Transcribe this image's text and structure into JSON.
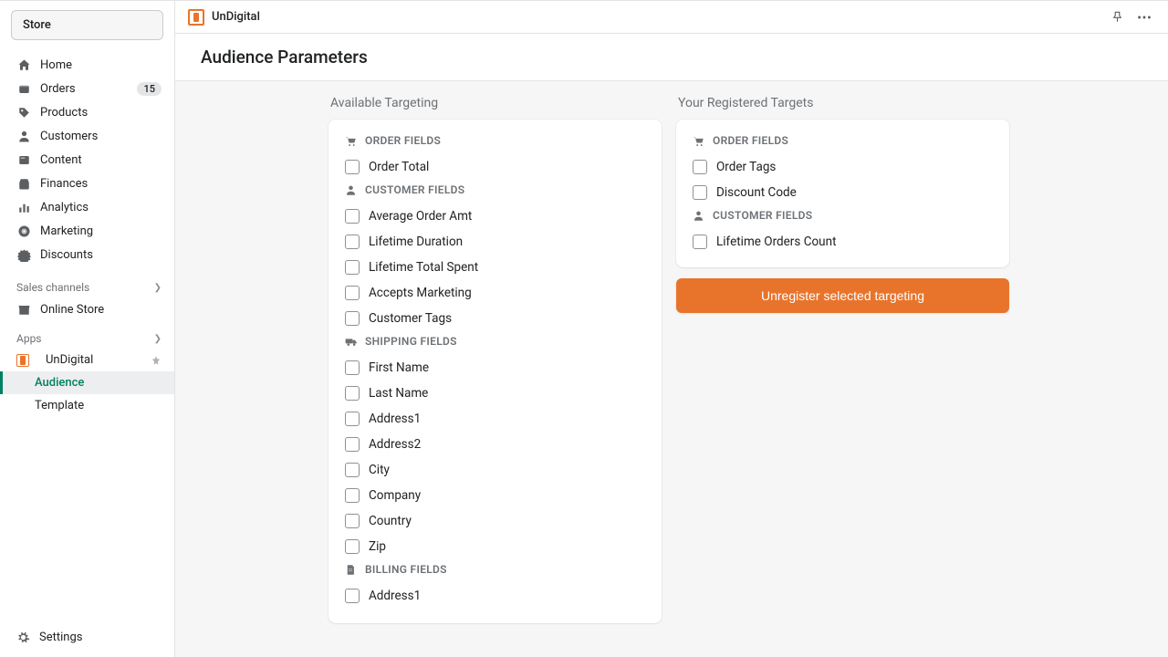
{
  "store_label": "Store",
  "nav": {
    "home": "Home",
    "orders": "Orders",
    "orders_badge": "15",
    "products": "Products",
    "customers": "Customers",
    "content": "Content",
    "finances": "Finances",
    "analytics": "Analytics",
    "marketing": "Marketing",
    "discounts": "Discounts"
  },
  "sales_channels_label": "Sales channels",
  "online_store": "Online Store",
  "apps_label": "Apps",
  "app_name": "UnDigital",
  "app_sub": {
    "audience": "Audience",
    "template": "Template"
  },
  "settings_label": "Settings",
  "topbar_title": "UnDigital",
  "page_title": "Audience Parameters",
  "columns": {
    "available_header": "Available Targeting",
    "registered_header": "Your Registered Targets"
  },
  "groups": {
    "order": "ORDER FIELDS",
    "customer": "CUSTOMER FIELDS",
    "shipping": "SHIPPING FIELDS",
    "billing": "BILLING FIELDS"
  },
  "available": {
    "order": [
      "Order Total"
    ],
    "customer": [
      "Average Order Amt",
      "Lifetime Duration",
      "Lifetime Total Spent",
      "Accepts Marketing",
      "Customer Tags"
    ],
    "shipping": [
      "First Name",
      "Last Name",
      "Address1",
      "Address2",
      "City",
      "Company",
      "Country",
      "Zip"
    ],
    "billing": [
      "Address1"
    ]
  },
  "registered": {
    "order": [
      "Order Tags",
      "Discount Code"
    ],
    "customer": [
      "Lifetime Orders Count"
    ]
  },
  "unregister_button": "Unregister selected targeting"
}
